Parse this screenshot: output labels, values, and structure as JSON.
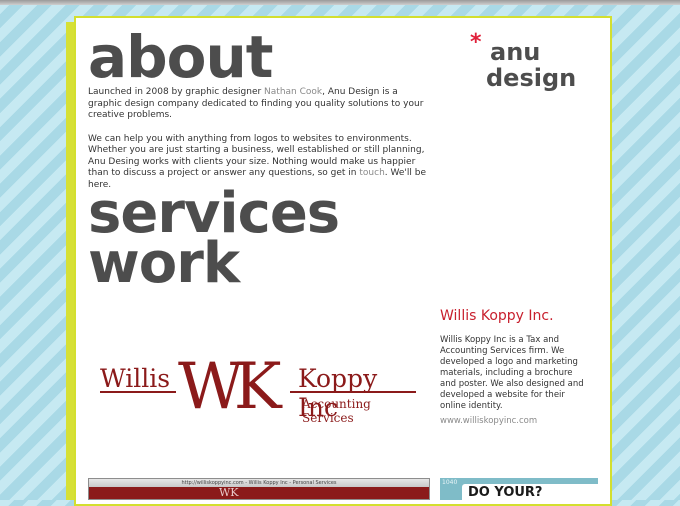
{
  "headings": {
    "about": "about",
    "services": "services",
    "work": "work"
  },
  "logo": {
    "star": "*",
    "line1": "anu",
    "line2": "design"
  },
  "about": {
    "p1_before": "Launched in 2008 by graphic designer ",
    "p1_link": "Nathan Cook",
    "p1_after": ", Anu Design is a graphic design company dedicated to finding you quality solutions to your creative problems.",
    "p2_before": "We can help you with anything from logos to websites to environments. Whether you are just starting a business, well established or still planning, Anu Desing works with clients your size. Nothing would make us happier than to discuss a project or answer any questions, so get in ",
    "p2_link": "touch",
    "p2_after": ". We'll be here."
  },
  "separator": "· · ·",
  "project": {
    "title": "Willis Koppy Inc.",
    "description": "Willis Koppy Inc is a Tax and Accounting Services firm. We developed a logo and marketing materials, including a brochure and poster. We also designed and developed a website for their online identity.",
    "url": "www.williskopyinc.com",
    "logo_willis": "Willis",
    "logo_monogram": "WK",
    "logo_koppy": "Koppy Inc",
    "logo_accounting": "Accounting Services"
  },
  "thumbnails": {
    "browser_title": "http://williskoppyinc.com - Willis Koppy Inc - Personal Services",
    "browser_mark": "WK",
    "poster_year": "1040",
    "poster_text": "DO YOUR?"
  },
  "colors": {
    "accent_red": "#c8202e",
    "heading_gray": "#4d4d4d",
    "border_yellow": "#d3df2f",
    "wk_red": "#8b1a1a",
    "bg_blue": "#bfe4ee"
  }
}
